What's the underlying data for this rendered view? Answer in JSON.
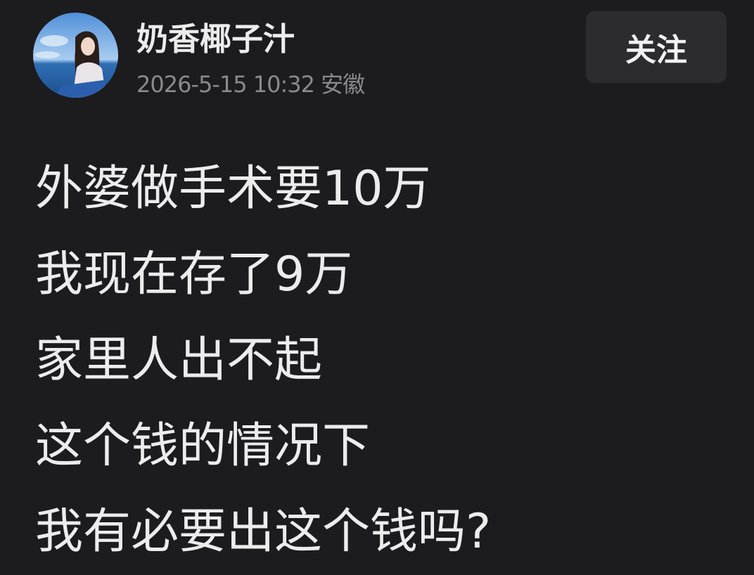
{
  "post": {
    "author": {
      "name": "奶香椰子汁",
      "avatar_icon": "user-avatar-photo"
    },
    "timestamp": "2026-5-15 10:32",
    "location": "安徽",
    "follow_label": "关注",
    "lines": [
      "外婆做手术要10万",
      "我现在存了9万",
      "家里人出不起",
      "这个钱的情况下",
      "我有必要出这个钱吗?"
    ]
  },
  "colors": {
    "background": "#1c1c1e",
    "button_background": "#2c2c2e",
    "primary_text": "#ececec",
    "secondary_text": "#8a8a8e"
  }
}
